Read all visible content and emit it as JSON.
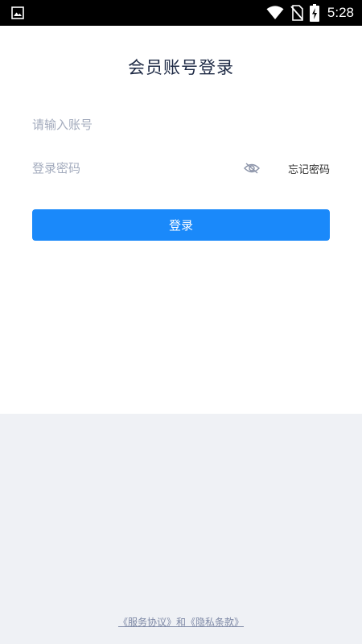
{
  "status_bar": {
    "time": "5:28",
    "icons": [
      "gallery-icon",
      "wifi-icon",
      "no-sim-icon",
      "battery-charging-icon"
    ]
  },
  "login": {
    "title": "会员账号登录",
    "account_placeholder": "请输入账号",
    "account_value": "",
    "password_placeholder": "登录密码",
    "password_value": "",
    "password_visibility_icon": "eye-off-icon",
    "forgot_password": "忘记密码",
    "submit_label": "登录"
  },
  "footer": {
    "service_agreement": "《服务协议》",
    "conjunction": "和",
    "privacy_policy": "《隐私条款》"
  },
  "colors": {
    "primary": "#1a89fa",
    "title": "#1e2a45",
    "placeholder": "#a3abbd",
    "page_background": "#eff1f5",
    "footer_text": "#7e89a6"
  }
}
